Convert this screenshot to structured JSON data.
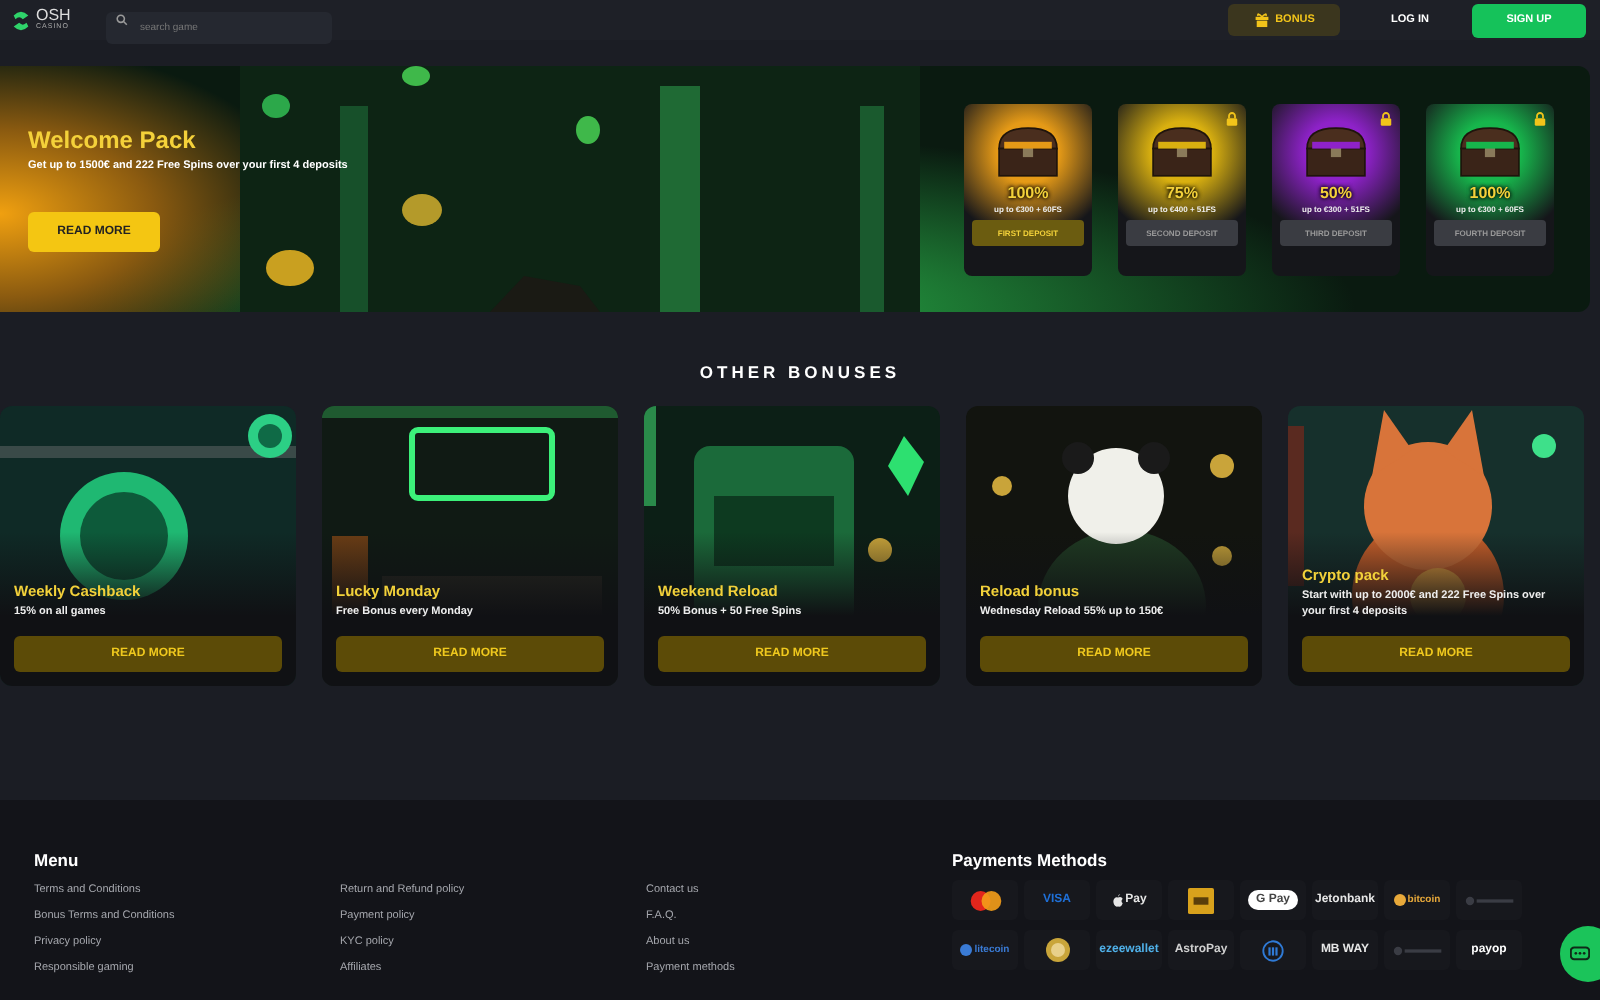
{
  "header": {
    "logo": {
      "name": "OSH",
      "tagline": "CASINO"
    },
    "search": {
      "placeholder": "search game"
    },
    "bonus_button": "BONUS",
    "login": "LOG IN",
    "signup": "SIGN UP"
  },
  "welcome": {
    "title": "Welcome Pack",
    "subtitle": "Get up to 1500€ and 222 Free Spins over your first 4 deposits",
    "button": "READ MORE",
    "deposits": [
      {
        "percent": "100%",
        "detail": "up to €300 + 60FS",
        "button": "FIRST DEPOSIT",
        "selected": true,
        "locked": false,
        "color": "#e59a17"
      },
      {
        "percent": "75%",
        "detail": "up to €400 + 51FS",
        "button": "SECOND DEPOSIT",
        "selected": false,
        "locked": true,
        "color": "#d9b010"
      },
      {
        "percent": "50%",
        "detail": "up to €300 + 51FS",
        "button": "THIRD DEPOSIT",
        "selected": false,
        "locked": true,
        "color": "#8e22c9"
      },
      {
        "percent": "100%",
        "detail": "up to €300 + 60FS",
        "button": "FOURTH DEPOSIT",
        "selected": false,
        "locked": true,
        "color": "#17b64c"
      }
    ]
  },
  "other_bonuses": {
    "title": "OTHER BONUSES",
    "cards": [
      {
        "title": "Weekly Cashback",
        "description": "15% on all games",
        "button": "READ MORE"
      },
      {
        "title": "Lucky Monday",
        "description": "Free Bonus every Monday",
        "button": "READ MORE"
      },
      {
        "title": "Weekend Reload",
        "description": "50% Bonus + 50 Free Spins",
        "button": "READ MORE"
      },
      {
        "title": "Reload bonus",
        "description": "Wednesday Reload 55% up to 150€",
        "button": "READ MORE"
      },
      {
        "title": "Crypto pack",
        "description": "Start with up to 2000€ and 222 Free Spins over your first 4 deposits",
        "button": "READ MORE"
      }
    ]
  },
  "footer": {
    "menu_title": "Menu",
    "links": [
      [
        "Terms and Conditions",
        "Bonus Terms and Conditions",
        "Privacy policy",
        "Responsible gaming"
      ],
      [
        "Return and Refund policy",
        "Payment policy",
        "KYC policy",
        "Affiliates"
      ],
      [
        "Contact us",
        "F.A.Q.",
        "About us",
        "Payment methods"
      ]
    ],
    "payments_title": "Payments Methods",
    "payments": [
      {
        "kind": "mastercard"
      },
      {
        "kind": "text",
        "label": "VISA",
        "color": "#1f6fd6"
      },
      {
        "kind": "apple",
        "label": "Pay",
        "color": "#e6e6e6"
      },
      {
        "kind": "voucher"
      },
      {
        "kind": "pill",
        "label": "G Pay",
        "color": "#444444"
      },
      {
        "kind": "text",
        "label": "Jetonbank",
        "color": "#e6e6e6"
      },
      {
        "kind": "coin-text",
        "label": "bitcoin",
        "color": "#e8a93a"
      },
      {
        "kind": "faint"
      },
      {
        "kind": "coin-text",
        "label": "litecoin",
        "color": "#3a7bd5"
      },
      {
        "kind": "doge"
      },
      {
        "kind": "text",
        "label": "ezeewallet",
        "color": "#4fb0e8"
      },
      {
        "kind": "text",
        "label": "AstroPay",
        "color": "#d0d0d0"
      },
      {
        "kind": "bank"
      },
      {
        "kind": "text",
        "label": "MB WAY",
        "color": "#e6e6e6"
      },
      {
        "kind": "faint"
      },
      {
        "kind": "text",
        "label": "payop",
        "color": "#ffffff"
      }
    ]
  }
}
